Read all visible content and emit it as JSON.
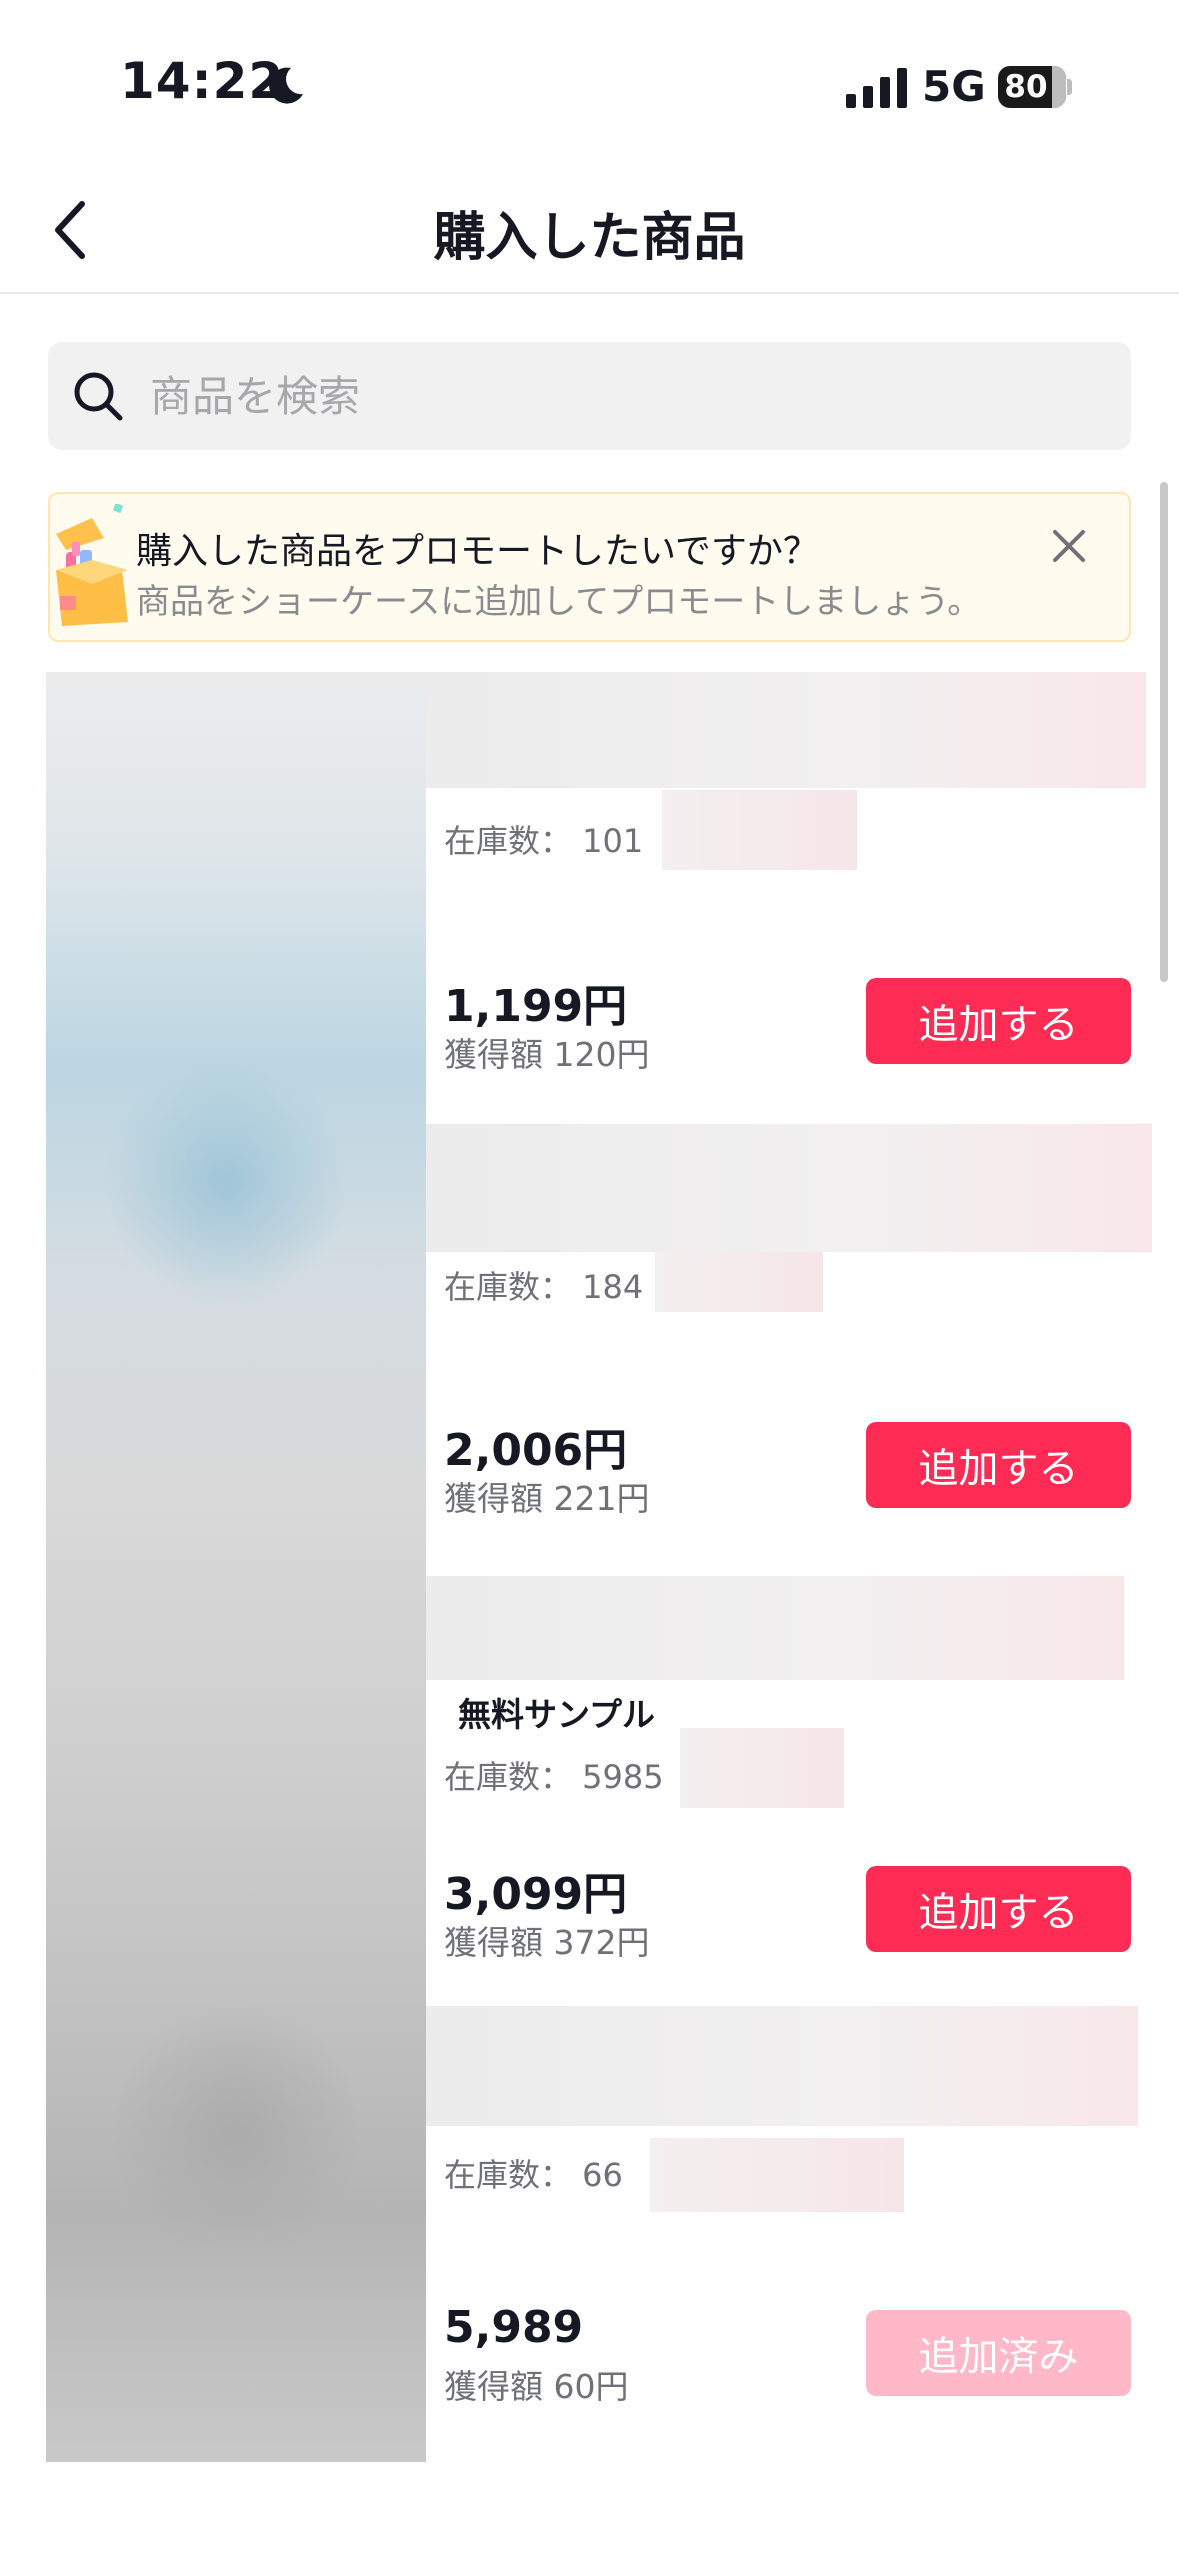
{
  "status_bar": {
    "time": "14:22",
    "network": "5G",
    "battery": "80",
    "battery_level": 0.8
  },
  "header": {
    "title": "購入した商品"
  },
  "search": {
    "placeholder": "商品を検索"
  },
  "promo": {
    "title": "購入した商品をプロモートしたいですか？",
    "subtitle": "商品をショーケースに追加してプロモートしましょう。"
  },
  "products": [
    {
      "stock_label": "在庫数： 101",
      "badge": "",
      "price": "1,199円",
      "earn": "獲得額 120円",
      "button": "追加する",
      "added": false
    },
    {
      "stock_label": "在庫数： 184",
      "badge": "",
      "price": "2,006円",
      "earn": "獲得額 221円",
      "button": "追加する",
      "added": false
    },
    {
      "stock_label": "在庫数： 5985",
      "badge": "無料サンプル",
      "price": "3,099円",
      "earn": "獲得額 372円",
      "button": "追加する",
      "added": false
    },
    {
      "stock_label": "在庫数： 66",
      "badge": "",
      "price": "5,989",
      "earn": "獲得額 60円",
      "button": "追加済み",
      "added": true
    }
  ],
  "colors": {
    "accent": "#fe2c55",
    "accent_disabled": "#ffb8c7",
    "promo_bg": "#fffbee"
  }
}
